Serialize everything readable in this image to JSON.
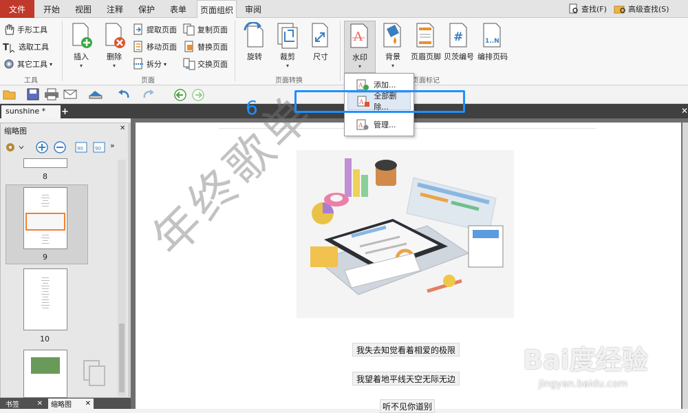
{
  "menubar": {
    "file": "文件",
    "tabs": [
      "开始",
      "视图",
      "注释",
      "保护",
      "表单",
      "页面组织",
      "审阅"
    ],
    "active_index": 5,
    "search": "查找(F)",
    "advanced_search": "高级查找(S)"
  },
  "ribbon": {
    "tools": {
      "hand": "手形工具",
      "select": "选取工具",
      "other": "其它工具",
      "group": "工具"
    },
    "page": {
      "insert": "插入",
      "delete": "删除",
      "extract": "提取页面",
      "move": "移动页面",
      "split": "拆分",
      "copy": "复制页面",
      "replace": "替换页面",
      "swap": "交换页面",
      "group": "页面"
    },
    "transform": {
      "rotate": "旋转",
      "crop": "裁剪",
      "size": "尺寸",
      "group": "页面转换"
    },
    "marks": {
      "watermark": "水印",
      "background": "背景",
      "header_footer": "页眉页脚",
      "bates": "贝茨编号",
      "numbering": "编排页码",
      "group": "页面标记"
    }
  },
  "document": {
    "tab": "sunshine *"
  },
  "panel": {
    "title": "缩略图",
    "pages": [
      "8",
      "9",
      "10"
    ],
    "tabs": [
      "书签",
      "缩略图"
    ]
  },
  "dropdown": {
    "items": [
      "添加...",
      "全部删除...",
      "管理..."
    ]
  },
  "annotation": {
    "step": "6"
  },
  "page": {
    "watermark": "年终歌单",
    "lyrics": [
      "我失去知觉看着相爱的极限",
      "我望着地平线天空无际无边",
      "听不见你道别"
    ]
  },
  "brand": {
    "logo": "Bai度经验",
    "url": "jingyan.baidu.com"
  },
  "colors": {
    "file_tab": "#c0392b",
    "highlight": "#1e90ff",
    "accent": "#3a7fc1"
  }
}
